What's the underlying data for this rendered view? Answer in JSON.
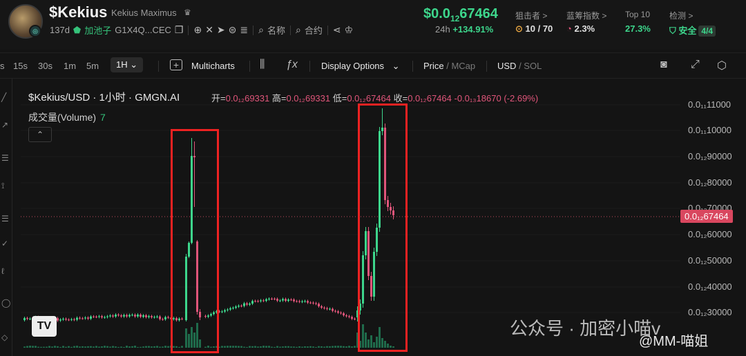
{
  "header": {
    "token_name": "$Kekius",
    "token_fullname": "Kekius Maximus",
    "age": "137d",
    "pool_label": "加池子",
    "address": "G1X4Q...CEC",
    "search_label": "名称",
    "contract_label": "合约",
    "price_prefix": "$0.0",
    "price_sub": "12",
    "price_rest": "67464",
    "change_label": "24h",
    "change_value": "+134.91%",
    "stats": [
      {
        "label": "狙击者 >",
        "value": "10 / 70"
      },
      {
        "label": "蓝筹指数 >",
        "value": "2.3%"
      },
      {
        "label": "Top 10",
        "value": "27.3%"
      },
      {
        "label": "检测 >",
        "value": "安全",
        "badge": "4/4"
      }
    ]
  },
  "toolbar": {
    "intervals": [
      "s",
      "15s",
      "30s",
      "1m",
      "5m"
    ],
    "active_interval": "1H",
    "multicharts": "Multicharts",
    "display_options": "Display Options",
    "price": "Price",
    "mcap": "MCap",
    "usd": "USD",
    "sol": "SOL"
  },
  "legend": {
    "title": "$Kekius/USD · 1小时 · GMGN.AI",
    "open_label": "开=",
    "open_value": "0.0₁₂69331",
    "high_label": "高=",
    "high_value": "0.0₁₂69331",
    "low_label": "低=",
    "low_value": "0.0₁₂67464",
    "close_label": "收=",
    "close_value": "0.0₁₂67464",
    "change": "-0.0₁₃18670 (-2.69%)",
    "volume_label": "成交量(Volume)",
    "volume_value": "7"
  },
  "axis": {
    "labels": [
      "0.0₁₁11000",
      "0.0₁₁10000",
      "0.0₁₂90000",
      "0.0₁₂80000",
      "0.0₁₂70000",
      "0.0₁₂60000",
      "0.0₁₂50000",
      "0.0₁₂40000",
      "0.0₁₂30000"
    ],
    "current_price": "0.0₁₂67464"
  },
  "watermark": {
    "text": "公众号 · 加密小喵v",
    "signature": "@MM-喵姐"
  },
  "colors": {
    "up": "#3dd68c",
    "down": "#e0557a",
    "highlight": "#e22222"
  }
}
